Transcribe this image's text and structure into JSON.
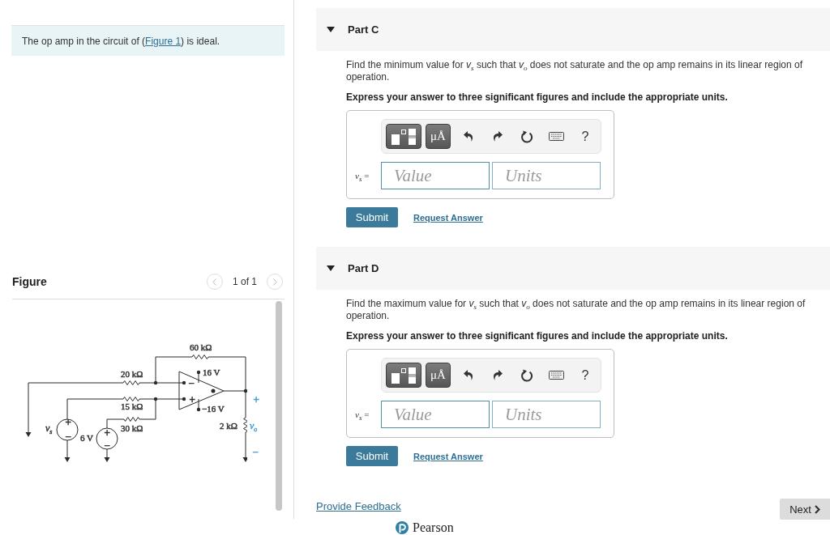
{
  "problem": {
    "text_before": "The op amp in the circuit of (",
    "link": "Figure 1",
    "text_after": ") is ideal."
  },
  "figure": {
    "title": "Figure",
    "pager": "1 of 1",
    "prev": {
      "disabled": true
    },
    "next": {
      "disabled": true
    },
    "circuit": {
      "labels": [
        {
          "text": "60 kΩ",
          "kind": "value",
          "color": "#333333"
        },
        {
          "text": "20 kΩ",
          "kind": "value",
          "color": "#333333"
        },
        {
          "text": "16 V",
          "kind": "value",
          "color": "#333333"
        },
        {
          "text": "−",
          "kind": "sign",
          "color": "#333333"
        },
        {
          "text": "+",
          "kind": "sign",
          "color": "#333333"
        },
        {
          "text": "+",
          "kind": "sign",
          "color": "#4a9fd8"
        },
        {
          "text": "15 kΩ",
          "kind": "value",
          "color": "#333333"
        },
        {
          "text": "−16 V",
          "kind": "value",
          "color": "#333333"
        },
        {
          "text": "*v*$_{s}$",
          "kind": "variable",
          "color": "#333333"
        },
        {
          "text": "+",
          "kind": "sign",
          "color": "#333333"
        },
        {
          "text": "30 kΩ",
          "kind": "value",
          "color": "#333333"
        },
        {
          "text": "2 kΩ",
          "kind": "value",
          "color": "#333333"
        },
        {
          "text": "*v*$_{o}$",
          "kind": "variable",
          "color": "#4a9fd8"
        },
        {
          "text": "+",
          "kind": "sign",
          "color": "#333333"
        },
        {
          "text": "−",
          "kind": "sign",
          "color": "#333333"
        },
        {
          "text": "6 V",
          "kind": "value",
          "color": "#333333"
        },
        {
          "text": "−",
          "kind": "sign",
          "color": "#333333"
        },
        {
          "text": "−",
          "kind": "sign",
          "color": "#4a9fd8"
        }
      ]
    }
  },
  "parts": [
    {
      "title": "Part C",
      "expanded": true,
      "prompt": "Find the minimum value for *v*$_{s}$ such that *v*$_{o}$ does not saturate and the op amp remains in its linear region of operation.",
      "instruction": "Express your answer to three significant figures and include the appropriate units.",
      "toolbar": [
        {
          "kind": "templates"
        },
        {
          "kind": "units",
          "label": "μÅ"
        },
        {
          "kind": "undo"
        },
        {
          "kind": "redo"
        },
        {
          "kind": "reset"
        },
        {
          "kind": "keyboard"
        },
        {
          "kind": "help",
          "label": "?"
        }
      ],
      "answer_label": "*v*$_{s}$ =",
      "value_placeholder": "Value",
      "units_placeholder": "Units",
      "submit": "Submit",
      "request": "Request Answer"
    },
    {
      "title": "Part D",
      "expanded": true,
      "prompt": "Find the maximum value for *v*$_{s}$ such that *v*$_{o}$ does not saturate and the op amp remains in its linear region of operation.",
      "instruction": "Express your answer to three significant figures and include the appropriate units.",
      "toolbar": [
        {
          "kind": "templates"
        },
        {
          "kind": "units",
          "label": "μÅ"
        },
        {
          "kind": "undo"
        },
        {
          "kind": "redo"
        },
        {
          "kind": "reset"
        },
        {
          "kind": "keyboard"
        },
        {
          "kind": "help",
          "label": "?"
        }
      ],
      "answer_label": "*v*$_{s}$ =",
      "value_placeholder": "Value",
      "units_placeholder": "Units",
      "submit": "Submit",
      "request": "Request Answer"
    }
  ],
  "footer": {
    "feedback": "Provide Feedback",
    "next": "Next",
    "logo": "Pearson"
  }
}
